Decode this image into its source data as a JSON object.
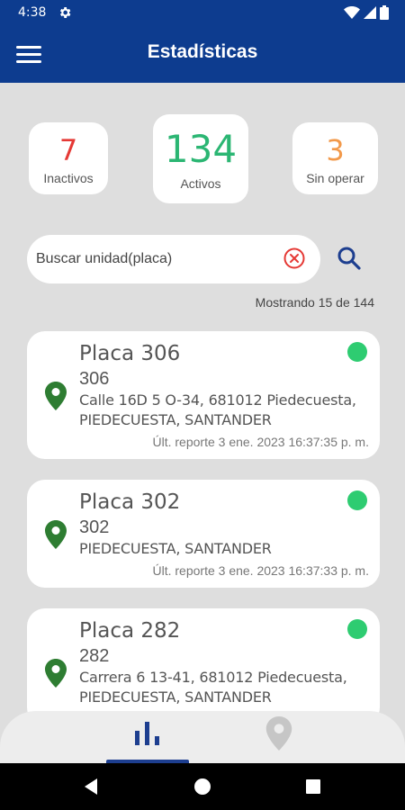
{
  "status_bar": {
    "time": "4:38",
    "icons": [
      "gear-icon",
      "wifi-icon",
      "signal-icon",
      "battery-icon"
    ]
  },
  "app_bar": {
    "title": "Estadísticas",
    "menu_icon": "hamburger-menu-icon"
  },
  "stats": {
    "inactive": {
      "value": "7",
      "label": "Inactivos",
      "color": "#e53935"
    },
    "active": {
      "value": "134",
      "label": "Activos",
      "color": "#2bb673"
    },
    "no_operation": {
      "value": "3",
      "label": "Sin operar",
      "color": "#f2994a"
    }
  },
  "search": {
    "placeholder": "Buscar unidad(placa)",
    "value": "",
    "clear_icon": "clear-circle-icon",
    "search_icon": "search-icon"
  },
  "results_count": "Mostrando 15 de 144",
  "units": [
    {
      "title": "Placa 306",
      "id": "306",
      "address": "Calle 16D 5 O-34, 681012 Piedecuesta, PIEDECUESTA, SANTANDER",
      "last_report": "Últ. reporte 3 ene. 2023 16:37:35 p. m.",
      "status_color": "#2ecc71"
    },
    {
      "title": "Placa 302",
      "id": "302",
      "address": "PIEDECUESTA, SANTANDER",
      "last_report": "Últ. reporte 3 ene. 2023 16:37:33 p. m.",
      "status_color": "#2ecc71"
    },
    {
      "title": "Placa 282",
      "id": "282",
      "address": "Carrera 6 13-41, 681012 Piedecuesta, PIEDECUESTA, SANTANDER",
      "last_report": "",
      "status_color": "#2ecc71"
    }
  ],
  "bottom_nav": {
    "items": [
      {
        "icon": "bar-chart-icon",
        "active": true
      },
      {
        "icon": "map-pin-icon",
        "active": false
      }
    ]
  },
  "colors": {
    "primary": "#0d3c8f",
    "background": "#dedede",
    "pin": "#2e7d32"
  }
}
